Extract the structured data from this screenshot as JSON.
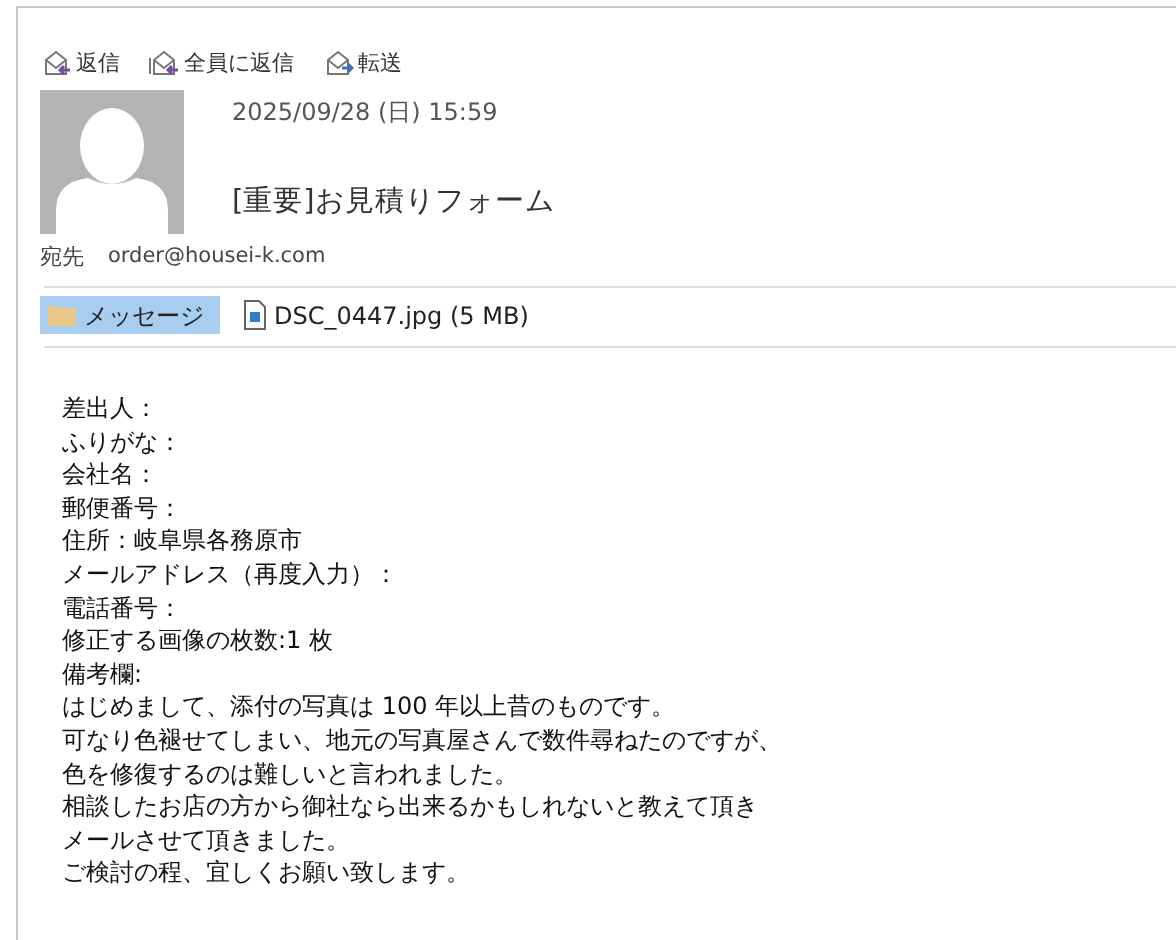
{
  "actions": [
    {
      "kind": "reply",
      "label": "返信"
    },
    {
      "kind": "reply_all",
      "label": "全員に返信"
    },
    {
      "kind": "forward",
      "label": "転送"
    }
  ],
  "header": {
    "date": "2025/09/28 (日) 15:59",
    "subject": "[重要]お見積りフォーム",
    "to_label": "宛先",
    "to": "order@housei-k.com"
  },
  "attachments": [
    {
      "kind": "message",
      "label": "メッセージ",
      "selected": true
    },
    {
      "kind": "file",
      "label": "DSC_0447.jpg (5 MB)",
      "selected": false
    }
  ],
  "body": [
    "差出人：",
    "ふりがな：",
    "会社名：",
    "郵便番号：",
    "住所：岐阜県各務原市",
    "メールアドレス（再度入力）：",
    "電話番号：",
    "修正する画像の枚数:1 枚",
    "備考欄:",
    "はじめまして、添付の写真は 100 年以上昔のものです。",
    "可なり色褪せてしまい、地元の写真屋さんで数件尋ねたのですが、",
    "色を修復するのは難しいと言われました。",
    "相談したお店の方から御社なら出来るかもしれないと教えて頂き",
    "メールさせて頂きました。",
    "ご検討の程、宜しくお願い致します。"
  ]
}
